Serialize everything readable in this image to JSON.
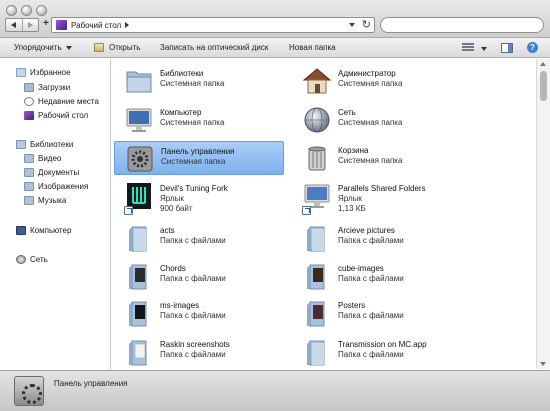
{
  "window": {
    "address_path": "Рабочий стол",
    "search_placeholder": ""
  },
  "toolbar": {
    "organize_label": "Упорядочить",
    "open_label": "Открыть",
    "burn_label": "Записать на оптический диск",
    "new_folder_label": "Новая папка",
    "help_glyph": "?"
  },
  "sidebar": {
    "favorites_header": "Избранное",
    "favorites": [
      "Загрузки",
      "Недавние места",
      "Рабочий стол"
    ],
    "libraries_header": "Библиотеки",
    "libraries": [
      "Видео",
      "Документы",
      "Изображения",
      "Музыка"
    ],
    "computer": "Компьютер",
    "network": "Сеть"
  },
  "items": [
    {
      "name": "Библиотеки",
      "sub": "Системная папка",
      "icon": "libraries-folder-icon"
    },
    {
      "name": "Администратор",
      "sub": "Системная папка",
      "icon": "home-icon"
    },
    {
      "name": "Компьютер",
      "sub": "Системная папка",
      "icon": "computer-icon"
    },
    {
      "name": "Сеть",
      "sub": "Системная папка",
      "icon": "network-globe-icon"
    },
    {
      "name": "Панель управления",
      "sub": "Системная папка",
      "icon": "control-panel-icon",
      "selected": true
    },
    {
      "name": "Корзина",
      "sub": "Системная папка",
      "icon": "trash-icon"
    },
    {
      "name": "Devil's Tuning Fork",
      "sub": "Ярлык",
      "size": "900 байт",
      "icon": "tuning-fork-icon"
    },
    {
      "name": "Parallels Shared Folders",
      "sub": "Ярлык",
      "size": "1,13 КБ",
      "icon": "monitor-icon"
    },
    {
      "name": "acts",
      "sub": "Папка с файлами",
      "icon": "folder-icon"
    },
    {
      "name": "Arcieve pictures",
      "sub": "Папка с файлами",
      "icon": "folder-icon"
    },
    {
      "name": "Chords",
      "sub": "Папка с файлами",
      "icon": "folder-icon"
    },
    {
      "name": "cube-images",
      "sub": "Папка с файлами",
      "icon": "folder-icon"
    },
    {
      "name": "ms-images",
      "sub": "Папка с файлами",
      "icon": "folder-icon"
    },
    {
      "name": "Posters",
      "sub": "Папка с файлами",
      "icon": "folder-icon"
    },
    {
      "name": "Raskin screenshots",
      "sub": "Папка с файлами",
      "icon": "folder-icon"
    },
    {
      "name": "Transmission on MC.app",
      "sub": "Папка с файлами",
      "icon": "folder-icon"
    }
  ],
  "status": {
    "selected_name": "Панель управления"
  },
  "colors": {
    "selection": "#8fbdf1",
    "folder": "#9db8d6"
  }
}
